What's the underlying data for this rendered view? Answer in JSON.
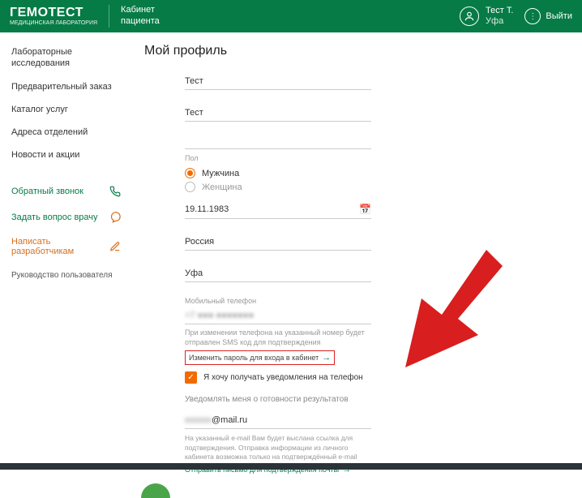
{
  "header": {
    "logo": "ГЕМОТЕСТ",
    "sublogo": "МЕДИЦИНСКАЯ ЛАБОРАТОРИЯ",
    "cabinet_line1": "Кабинет",
    "cabinet_line2": "пациента",
    "user_name": "Тест Т.",
    "user_city": "Уфа",
    "logout": "Выйти"
  },
  "sidebar": {
    "items": {
      "0": "Лабораторные исследования",
      "1": "Предварительный заказ",
      "2": "Каталог услуг",
      "3": "Адреса отделений",
      "4": "Новости и акции"
    },
    "actions": {
      "callback": "Обратный звонок",
      "ask_doctor": "Задать вопрос врачу",
      "write_devs": "Написать разработчикам"
    },
    "manual": "Руководство пользователя"
  },
  "main": {
    "title": "Мой профиль",
    "firstname": "Тест",
    "lastname": "Тест",
    "gender_label": "Пол",
    "gender_m": "Мужчина",
    "gender_f": "Женщина",
    "dob": "19.11.1983",
    "country": "Россия",
    "city": "Уфа",
    "phone_label": "Мобильный телефон",
    "phone_value": "+7 ●●● ●●●●●●●",
    "phone_hint": "При изменении телефона на указанный номер будет отправлен SMS код для подтверждения",
    "change_pw": "Изменить пароль для входа в кабинет",
    "checkbox_label": "Я хочу получать уведомления на телефон",
    "notify_head": "Уведомлять меня о готовности результатов",
    "email_domain": "@mail.ru",
    "email_hint": "На указанный e-mail Вам будет выслана ссылка для подтверждения. Отправка информации из личного кабинета возможна только на подтверждённый e-mail",
    "resend_link": "Отправить письмо для подтверждения почты"
  }
}
